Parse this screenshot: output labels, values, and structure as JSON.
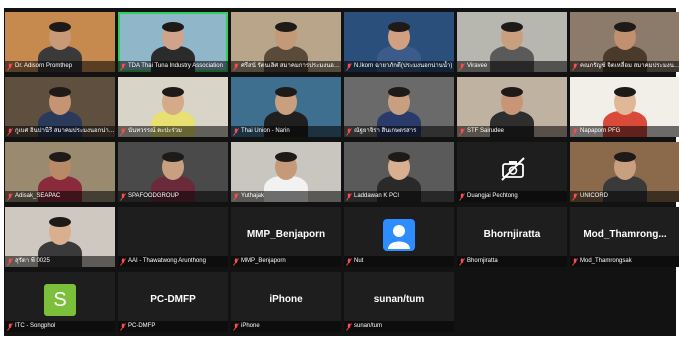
{
  "meeting": {
    "accent_active": "#2fd15c",
    "tiles": [
      {
        "name": "Dr. Adisorn Promthep",
        "video": true,
        "bg": "#c78a4e",
        "skin": "#c89a78",
        "shirt": "#3a3a3a"
      },
      {
        "name": "TDA Thai Tuna Industry Association",
        "video": true,
        "bg": "#8fb7c9",
        "skin": "#d0a48a",
        "shirt": "#2b2b2b",
        "active": true
      },
      {
        "name": "ศรีสนั่ รัตนเลิศ สมาคมการประมงนอกน่านน้ำไทย",
        "video": true,
        "bg": "#b9a58a",
        "skin": "#c39a78",
        "shirt": "#5a4a3a"
      },
      {
        "name": "N.Ikorn ฉายาภักดี(ประมงนอกน่านน้ำ)",
        "video": true,
        "bg": "#2a4f7a",
        "skin": "#d0a080",
        "shirt": "#3b5c8a"
      },
      {
        "name": "Viravee",
        "video": true,
        "bg": "#b7b7b0",
        "skin": "#c8a080",
        "shirt": "#5a5a5a"
      },
      {
        "name": "คณกรัญช์ จิตเหลื่อม สมาคมประมงนอกน่านน้ำ",
        "video": true,
        "bg": "#8c7a6a",
        "skin": "#c09070",
        "shirt": "#4a3a2a"
      },
      {
        "name": "กูเบศ อินปานีรี สมาคมประมงนอกน่านน้ำ",
        "video": true,
        "bg": "#5f4f3f",
        "skin": "#c49474",
        "shirt": "#2a3a5a"
      },
      {
        "name": "นันทวรรณ์ ตะปะร่วม",
        "video": true,
        "bg": "#d8d4c8",
        "skin": "#d4aa88",
        "shirt": "#e8e070"
      },
      {
        "name": "Thai Union - Narin",
        "video": true,
        "bg": "#3f6f8f",
        "skin": "#c8a080",
        "shirt": "#1f1f1f"
      },
      {
        "name": "ณัฐยาจิรา สินเกษตรสาร",
        "video": true,
        "bg": "#6a6a6a",
        "skin": "#c8a080",
        "shirt": "#2a3a6a"
      },
      {
        "name": "STF Sairudee",
        "video": true,
        "bg": "#bfb2a0",
        "skin": "#c89676",
        "shirt": "#2e2e2e"
      },
      {
        "name": "Napaporn PFG",
        "video": true,
        "bg": "#f2eee8",
        "skin": "#e0b898",
        "shirt": "#d94a3a"
      },
      {
        "name": "Adisak_SEAPAC",
        "video": true,
        "bg": "#9a8a70",
        "skin": "#b88a68",
        "shirt": "#8a2a3a"
      },
      {
        "name": "SPAFOODGROUP",
        "video": true,
        "bg": "#4a4a4a",
        "skin": "#c8a080",
        "shirt": "#6a2a3a"
      },
      {
        "name": "Yuthajak",
        "video": true,
        "bg": "#c9c6bf",
        "skin": "#c49a78",
        "shirt": "#f2f2f2"
      },
      {
        "name": "Laddawan K PCI",
        "video": true,
        "bg": "#5a5a5a",
        "skin": "#d8b090",
        "shirt": "#2a2a2a"
      },
      {
        "name": "Duangjai Pechtong",
        "video": false,
        "cam_off": true
      },
      {
        "name": "UNICORD",
        "video": true,
        "bg": "#8a6a4a",
        "skin": "#c8a080",
        "shirt": "#3a3a3a"
      },
      {
        "name": "สุรัดา พี 0025",
        "video": true,
        "bg": "#cfc8c0",
        "skin": "#d8b090",
        "shirt": "#3a3a3a"
      },
      {
        "name": "AAI - Thawatwong Arunthong",
        "video": false
      },
      {
        "name": "MMP_Benjaporn",
        "video": false,
        "big_name": "MMP_Benjaporn"
      },
      {
        "name": "Nut",
        "video": false,
        "avatar": true
      },
      {
        "name": "Bhornjiratta",
        "video": false,
        "big_name": "Bhornjiratta"
      },
      {
        "name": "Mod_Thamrongsak",
        "video": false,
        "big_name": "Mod_Thamrong..."
      },
      {
        "name": "ITC - Songphol",
        "video": false,
        "initial": "S"
      },
      {
        "name": "PC-DMFP",
        "video": false,
        "big_name": "PC-DMFP"
      },
      {
        "name": "iPhone",
        "video": false,
        "big_name": "iPhone"
      },
      {
        "name": "sunan/tum",
        "video": false,
        "big_name": "sunan/tum"
      }
    ]
  }
}
